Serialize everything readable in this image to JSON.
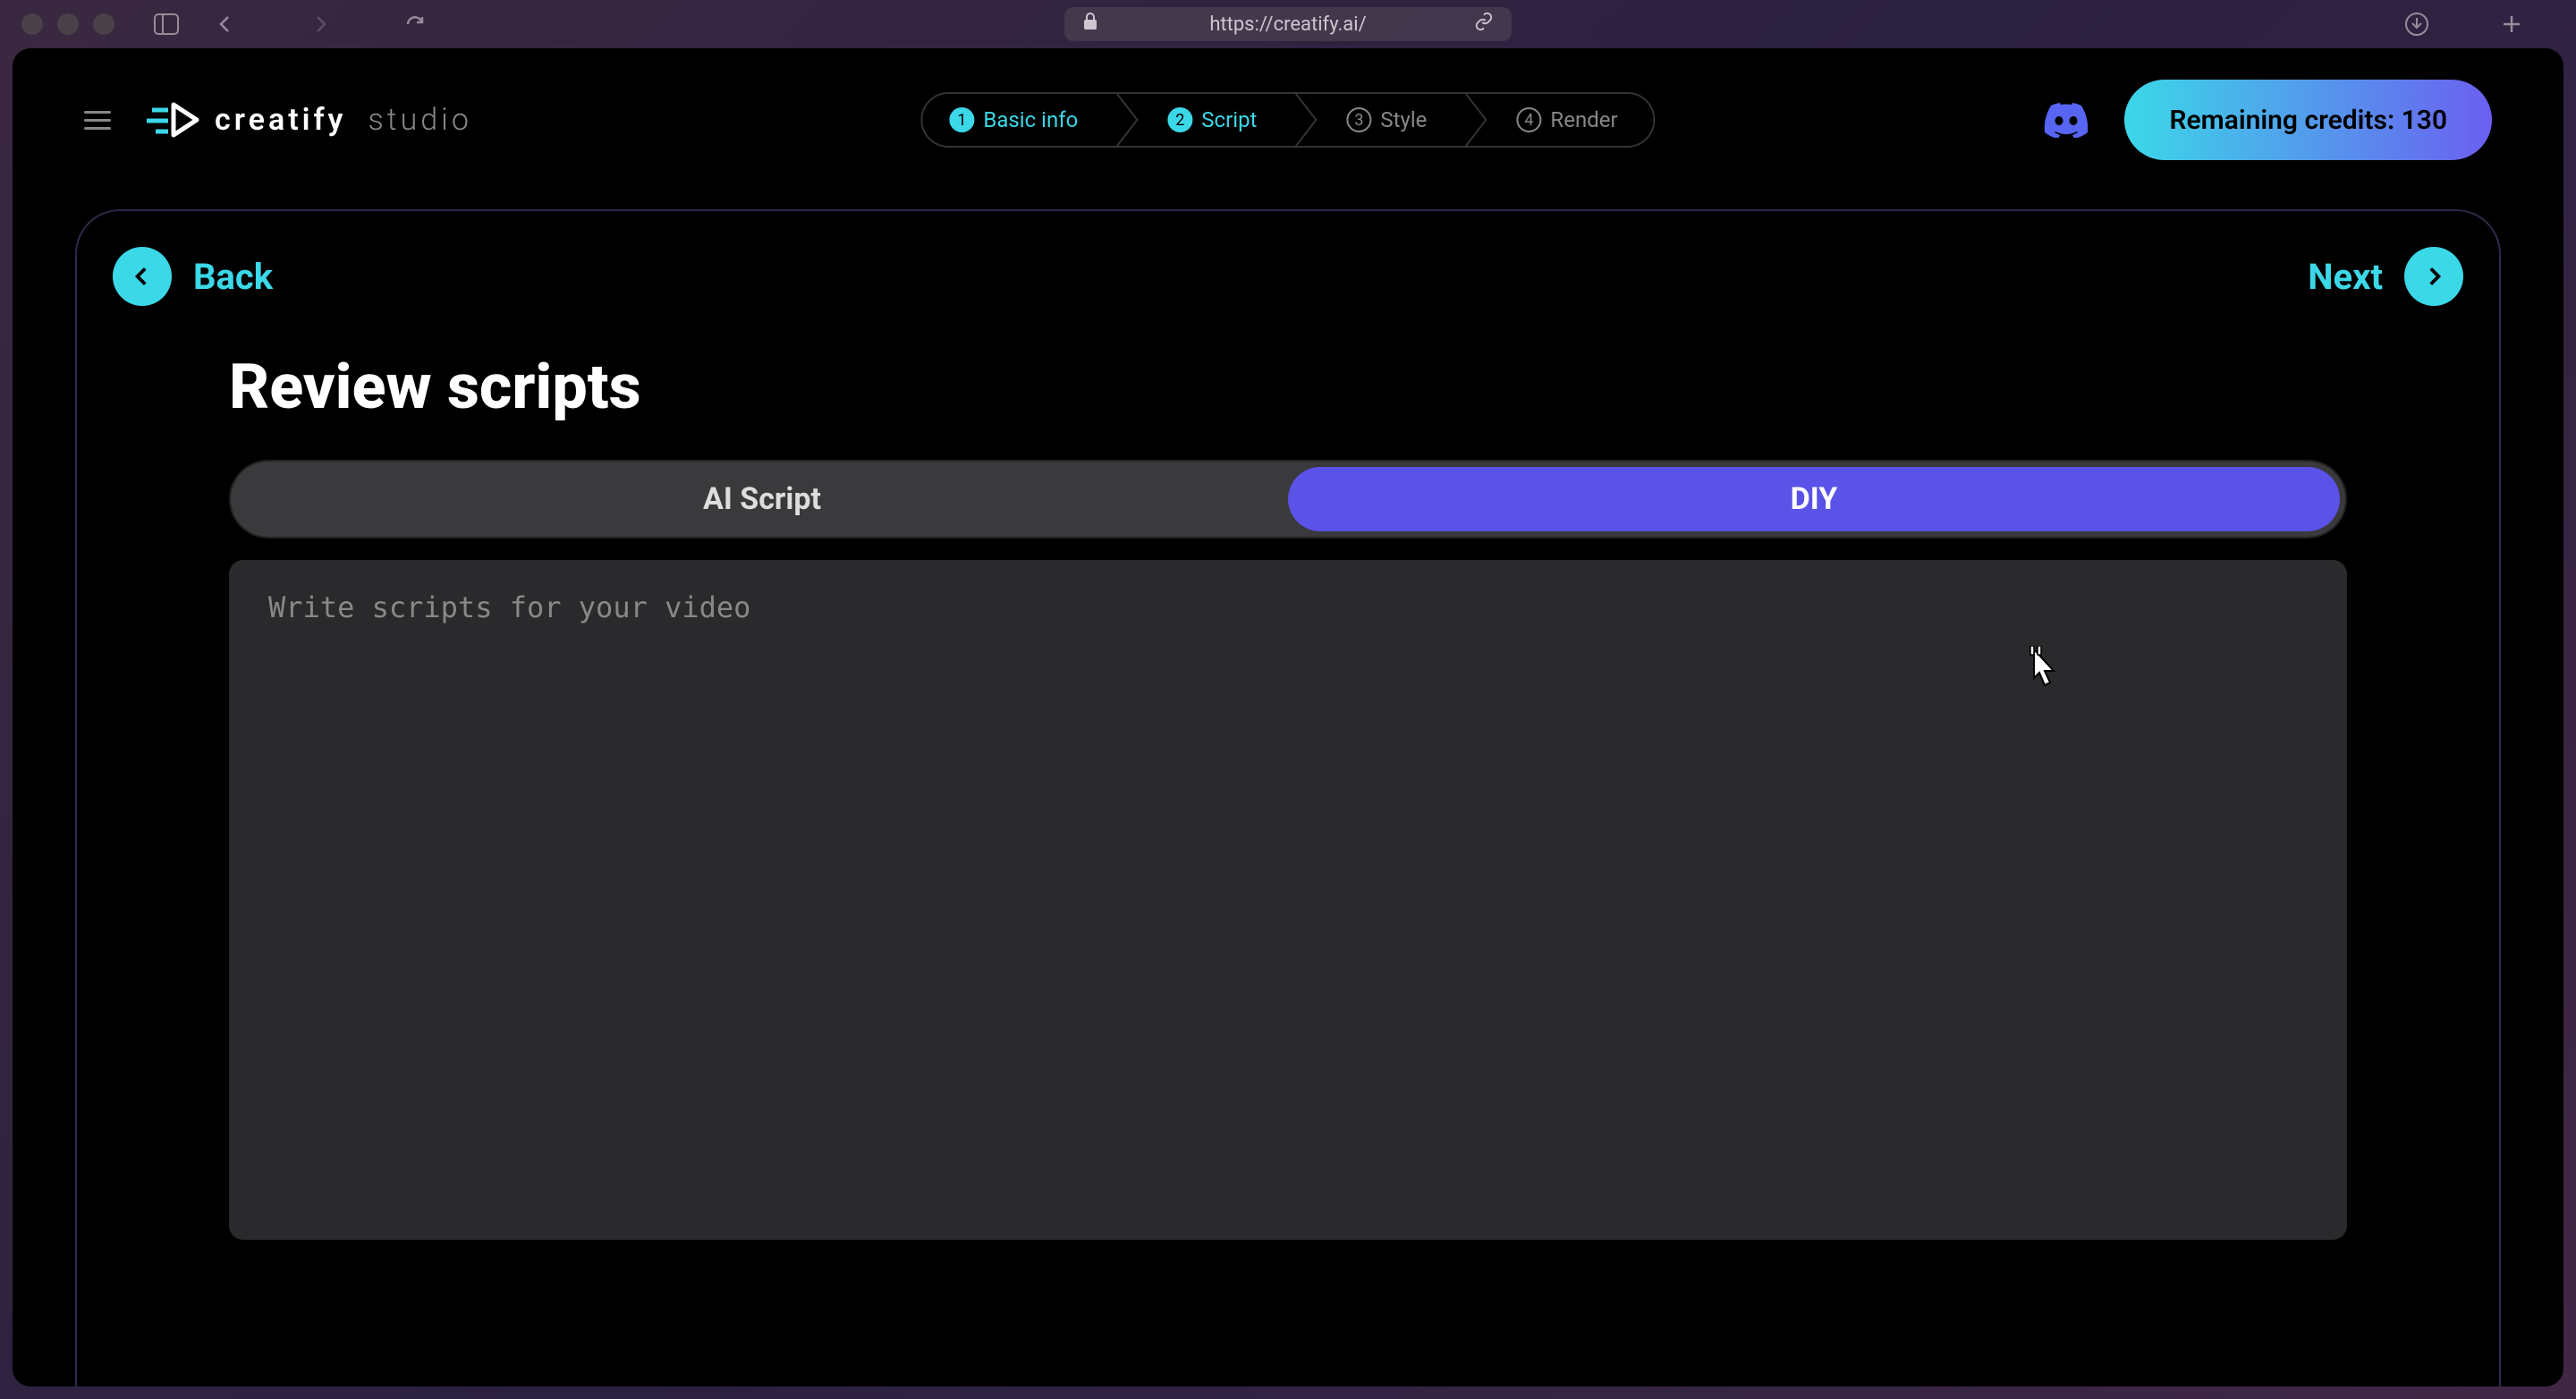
{
  "browser": {
    "url": "https://creatify.ai/"
  },
  "app": {
    "logo_main": "creatify",
    "logo_sub": "studio",
    "credits_label": "Remaining credits: 130"
  },
  "stepper": {
    "steps": [
      {
        "num": "1",
        "label": "Basic info"
      },
      {
        "num": "2",
        "label": "Script"
      },
      {
        "num": "3",
        "label": "Style"
      },
      {
        "num": "4",
        "label": "Render"
      }
    ]
  },
  "nav": {
    "back_label": "Back",
    "next_label": "Next"
  },
  "page": {
    "title": "Review scripts"
  },
  "tabs": {
    "ai_script": "AI Script",
    "diy": "DIY"
  },
  "editor": {
    "placeholder": "Write scripts for your video",
    "value": ""
  }
}
